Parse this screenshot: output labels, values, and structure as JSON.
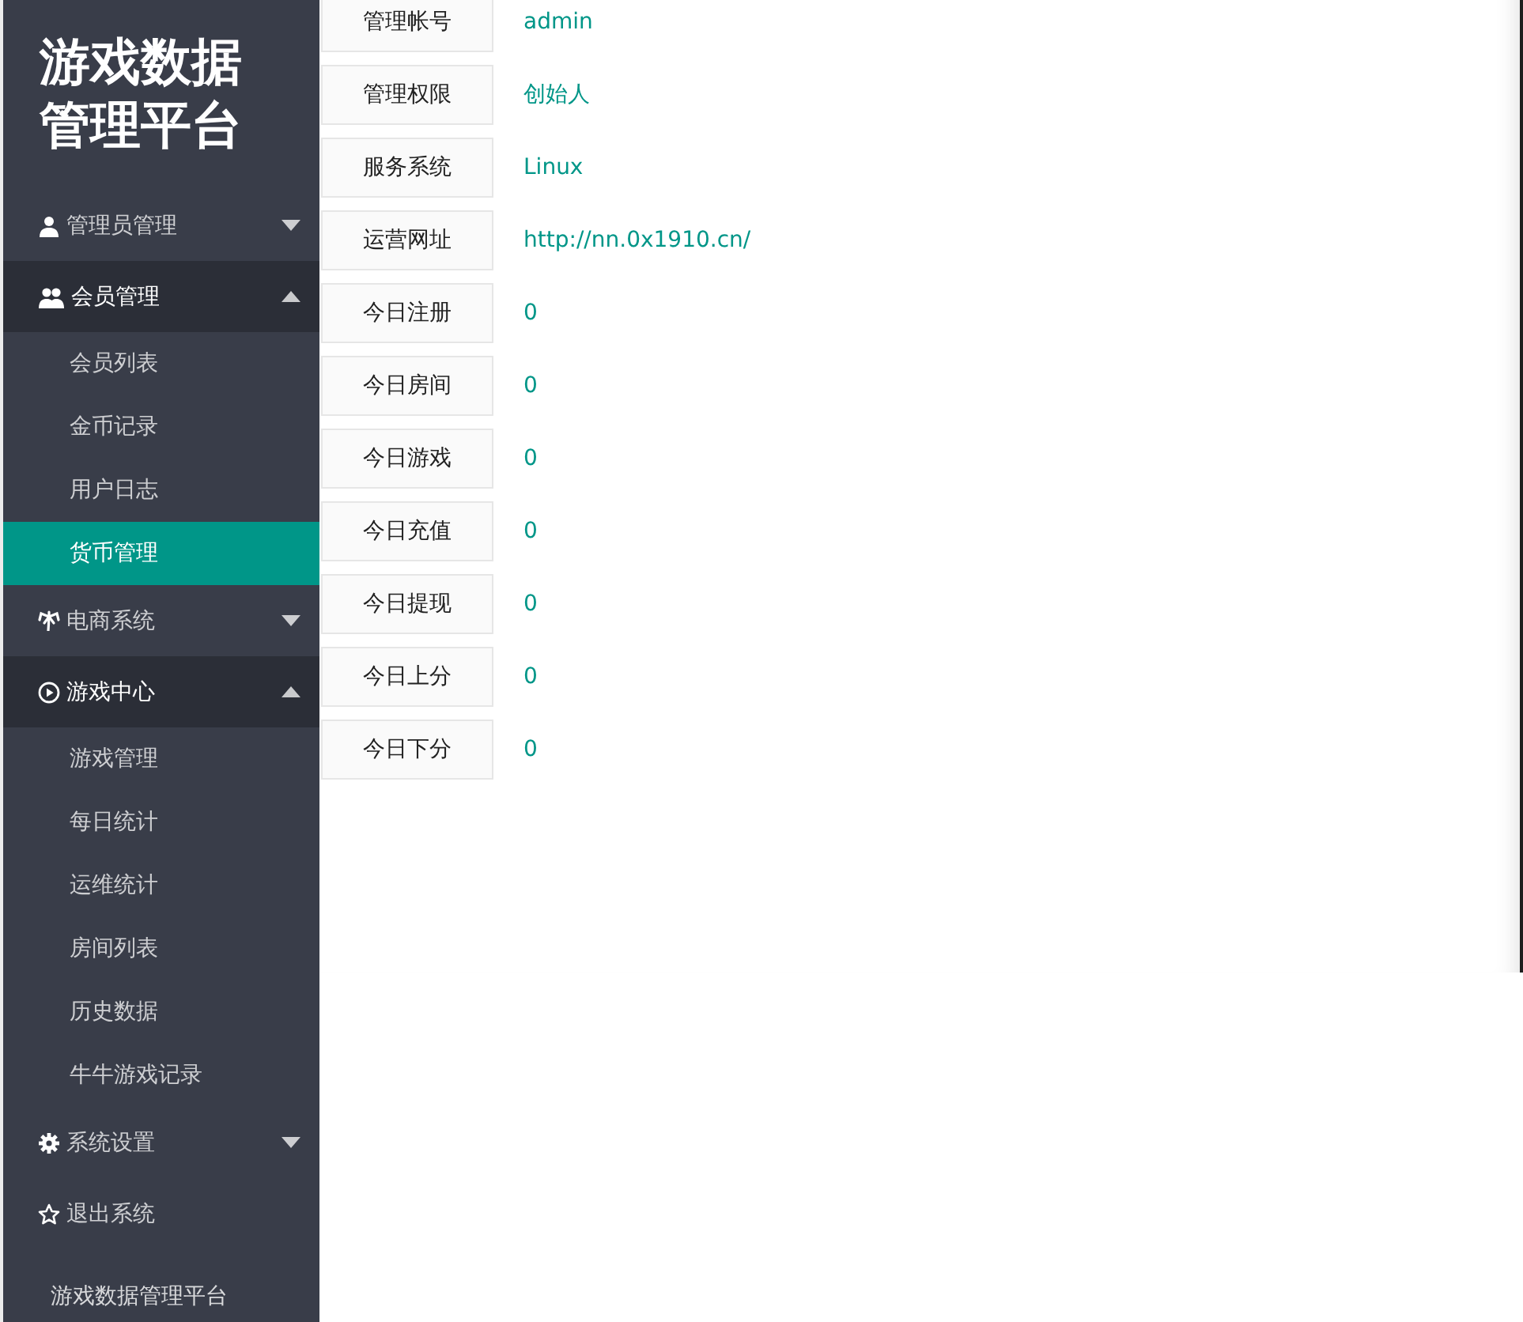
{
  "sidebar": {
    "logo": "游戏数据管理平台",
    "menu": [
      {
        "kind": "group",
        "label": "管理员管理",
        "expanded": false
      },
      {
        "kind": "group",
        "label": "会员管理",
        "expanded": true,
        "children": [
          {
            "label": "会员列表",
            "selected": false
          },
          {
            "label": "金币记录",
            "selected": false
          },
          {
            "label": "用户日志",
            "selected": false
          },
          {
            "label": "货币管理",
            "selected": true
          }
        ]
      },
      {
        "kind": "group",
        "label": "电商系统",
        "expanded": false
      },
      {
        "kind": "group",
        "label": "游戏中心",
        "expanded": true,
        "children": [
          {
            "label": "游戏管理",
            "selected": false
          },
          {
            "label": "每日统计",
            "selected": false
          },
          {
            "label": "运维统计",
            "selected": false
          },
          {
            "label": "房间列表",
            "selected": false
          },
          {
            "label": "历史数据",
            "selected": false
          },
          {
            "label": "牛牛游戏记录",
            "selected": false
          }
        ]
      },
      {
        "kind": "group",
        "label": "系统设置",
        "expanded": false
      },
      {
        "kind": "link",
        "label": "退出系统"
      }
    ],
    "footer": "游戏数据管理平台"
  },
  "info_rows": [
    {
      "label": "管理帐号",
      "value": "admin"
    },
    {
      "label": "管理权限",
      "value": "创始人"
    },
    {
      "label": "服务系统",
      "value": "Linux"
    },
    {
      "label": "运营网址",
      "value": "http://nn.0x1910.cn/"
    },
    {
      "label": "今日注册",
      "value": "0"
    },
    {
      "label": "今日房间",
      "value": "0"
    },
    {
      "label": "今日游戏",
      "value": "0"
    },
    {
      "label": "今日充值",
      "value": "0"
    },
    {
      "label": "今日提现",
      "value": "0"
    },
    {
      "label": "今日上分",
      "value": "0"
    },
    {
      "label": "今日下分",
      "value": "0"
    }
  ]
}
